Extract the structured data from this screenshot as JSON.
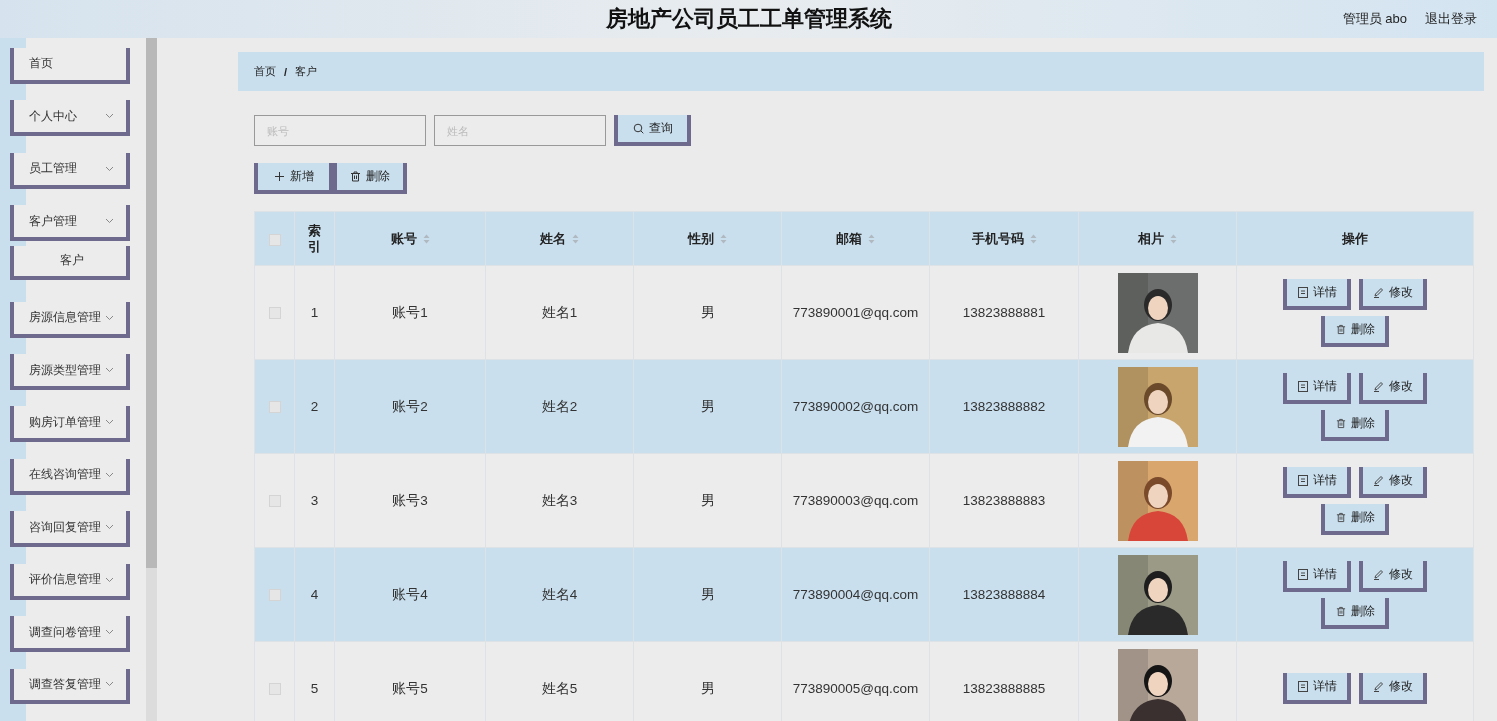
{
  "header": {
    "title": "房地产公司员工工单管理系统",
    "user": "管理员 abo",
    "logout": "退出登录"
  },
  "sidebar": {
    "items": [
      {
        "label": "首页",
        "kind": "link"
      },
      {
        "label": "个人中心",
        "kind": "menu",
        "expanded": false
      },
      {
        "label": "员工管理",
        "kind": "menu",
        "expanded": false
      },
      {
        "label": "客户管理",
        "kind": "menu",
        "expanded": true,
        "children": [
          {
            "label": "客户"
          }
        ]
      },
      {
        "label": "房源信息管理",
        "kind": "menu",
        "expanded": false
      },
      {
        "label": "房源类型管理",
        "kind": "menu",
        "expanded": false
      },
      {
        "label": "购房订单管理",
        "kind": "menu",
        "expanded": false
      },
      {
        "label": "在线咨询管理",
        "kind": "menu",
        "expanded": false
      },
      {
        "label": "咨询回复管理",
        "kind": "menu",
        "expanded": false
      },
      {
        "label": "评价信息管理",
        "kind": "menu",
        "expanded": false
      },
      {
        "label": "调查问卷管理",
        "kind": "menu",
        "expanded": false
      },
      {
        "label": "调查答复管理",
        "kind": "menu",
        "expanded": false
      }
    ]
  },
  "breadcrumb": {
    "items": [
      "首页",
      "客户"
    ],
    "separator": "/"
  },
  "search": {
    "fields": [
      {
        "placeholder": "账号"
      },
      {
        "placeholder": "姓名"
      }
    ],
    "button": "查询"
  },
  "toolbar": [
    {
      "label": "新增",
      "kind": "add"
    },
    {
      "label": "删除",
      "kind": "delete"
    }
  ],
  "table": {
    "select_all_checked": false,
    "columns": [
      {
        "label": "索引",
        "sortable": false
      },
      {
        "label": "账号",
        "sortable": true
      },
      {
        "label": "姓名",
        "sortable": true
      },
      {
        "label": "性别",
        "sortable": true
      },
      {
        "label": "邮箱",
        "sortable": true
      },
      {
        "label": "手机号码",
        "sortable": true
      },
      {
        "label": "相片",
        "sortable": true
      },
      {
        "label": "操作",
        "sortable": false
      }
    ],
    "rows": [
      {
        "checked": false,
        "index": "1",
        "account": "账号1",
        "name": "姓名1",
        "gender": "男",
        "email": "773890001@qq.com",
        "phone": "13823888881",
        "photo": {
          "kind": "picture"
        },
        "actions": [
          {
            "label": "详情",
            "kind": "detail"
          },
          {
            "label": "修改",
            "kind": "edit"
          },
          {
            "label": "删除",
            "kind": "delete"
          }
        ]
      },
      {
        "checked": false,
        "index": "2",
        "account": "账号2",
        "name": "姓名2",
        "gender": "男",
        "email": "773890002@qq.com",
        "phone": "13823888882",
        "photo": {
          "kind": "picture"
        },
        "actions": [
          {
            "label": "详情",
            "kind": "detail"
          },
          {
            "label": "修改",
            "kind": "edit"
          },
          {
            "label": "删除",
            "kind": "delete"
          }
        ]
      },
      {
        "checked": false,
        "index": "3",
        "account": "账号3",
        "name": "姓名3",
        "gender": "男",
        "email": "773890003@qq.com",
        "phone": "13823888883",
        "photo": {
          "kind": "picture"
        },
        "actions": [
          {
            "label": "详情",
            "kind": "detail"
          },
          {
            "label": "修改",
            "kind": "edit"
          },
          {
            "label": "删除",
            "kind": "delete"
          }
        ]
      },
      {
        "checked": false,
        "index": "4",
        "account": "账号4",
        "name": "姓名4",
        "gender": "男",
        "email": "773890004@qq.com",
        "phone": "13823888884",
        "photo": {
          "kind": "picture"
        },
        "actions": [
          {
            "label": "详情",
            "kind": "detail"
          },
          {
            "label": "修改",
            "kind": "edit"
          },
          {
            "label": "删除",
            "kind": "delete"
          }
        ]
      },
      {
        "checked": false,
        "index": "5",
        "account": "账号5",
        "name": "姓名5",
        "gender": "男",
        "email": "773890005@qq.com",
        "phone": "13823888885",
        "photo": {
          "kind": "picture"
        },
        "actions": [
          {
            "label": "详情",
            "kind": "detail"
          },
          {
            "label": "修改",
            "kind": "edit"
          }
        ]
      }
    ]
  }
}
